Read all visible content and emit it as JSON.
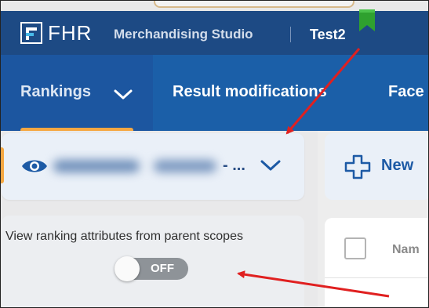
{
  "header": {
    "logo_text": "FHR",
    "product": "Merchandising Studio",
    "project": "Test2",
    "colors": {
      "brand_bar": "#1d4a84",
      "nav_bar": "#1b5fa8",
      "accent_orange": "#f5a742",
      "bookmark_green": "#2fa12f"
    },
    "icons": {
      "logo": "fhr-logo-icon",
      "bookmark": "bookmark-icon"
    }
  },
  "nav": {
    "tabs": [
      {
        "label": "Rankings",
        "active": true
      },
      {
        "label": "Result modifications",
        "active": false
      },
      {
        "label": "Face",
        "active": false
      }
    ],
    "dropdown_icon": "chevron-down-icon"
  },
  "scope_selector": {
    "visibility_icon": "eye-icon",
    "ellipsis": "- ...",
    "dropdown_icon": "chevron-down-icon"
  },
  "new_button": {
    "label": "New",
    "icon": "plus-icon"
  },
  "parent_scope": {
    "label": "View ranking attributes from parent scopes",
    "toggle_state": "OFF"
  },
  "table": {
    "column_header": "Nam"
  }
}
